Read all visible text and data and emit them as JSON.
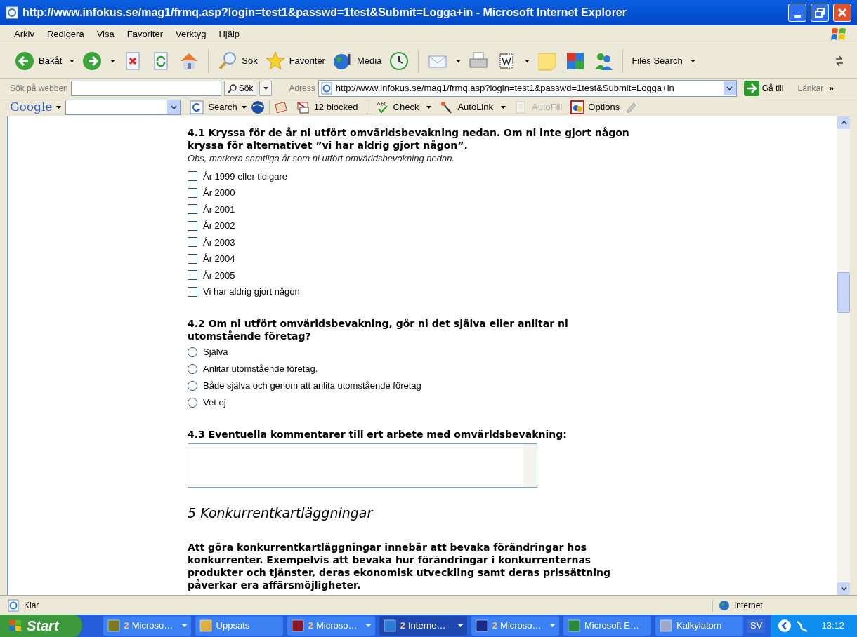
{
  "window": {
    "title": "http://www.infokus.se/mag1/frmq.asp?login=test1&passwd=1test&Submit=Logga+in - Microsoft Internet Explorer"
  },
  "menu": [
    "Arkiv",
    "Redigera",
    "Visa",
    "Favoriter",
    "Verktyg",
    "Hjälp"
  ],
  "toolbar": [
    {
      "label": "Bakåt",
      "dropdown": true
    },
    {
      "dropdown": true
    },
    {
      "dropdown": false
    },
    {
      "dropdown": false
    },
    {
      "dropdown": false
    },
    {
      "label": "Sök",
      "dropdown": false
    },
    {
      "label": "Favoriter",
      "dropdown": false
    },
    {
      "label": "Media",
      "dropdown": false
    },
    {
      "dropdown": false
    },
    {
      "dropdown": true
    },
    {
      "dropdown": false
    },
    {
      "dropdown": true
    },
    {
      "dropdown": false
    },
    {
      "dropdown": false
    },
    {
      "dropdown": false
    },
    {
      "label": "Files Search",
      "dropdown": true
    }
  ],
  "search_bar": {
    "label": "Sök på webben",
    "button": "Sök"
  },
  "address_bar": {
    "label": "Adress",
    "value": "http://www.infokus.se/mag1/frmq.asp?login=test1&passwd=1test&Submit=Logga+in",
    "go": "Gå till",
    "links": "Länkar",
    "more": "»"
  },
  "google_bar": {
    "logo": "Google",
    "search": "Search",
    "items": [
      {
        "label": "12 blocked",
        "dropdown": false,
        "disabled": false
      },
      {
        "label": "Check",
        "dropdown": true,
        "disabled": false
      },
      {
        "label": "AutoLink",
        "dropdown": true,
        "disabled": false
      },
      {
        "label": "AutoFill",
        "dropdown": false,
        "disabled": true
      },
      {
        "label": "Options",
        "dropdown": false,
        "disabled": false
      }
    ]
  },
  "content": {
    "q1": {
      "title": "4.1 Kryssa för de år ni utfört omvärldsbevakning nedan. Om ni inte gjort någon kryssa för alternativet ”vi har aldrig gjort någon”.",
      "note": "Obs, markera samtliga år som ni utfört omvärldsbevakning nedan.",
      "options": [
        {
          "label": "År 1999 eller tidigare",
          "checked": false
        },
        {
          "label": "År 2000",
          "checked": false
        },
        {
          "label": "År 2001",
          "checked": false
        },
        {
          "label": "År 2002",
          "checked": false
        },
        {
          "label": "År 2003",
          "checked": false
        },
        {
          "label": "År 2004",
          "checked": false
        },
        {
          "label": "År 2005",
          "checked": false
        },
        {
          "label": "Vi har aldrig gjort någon",
          "checked": false
        }
      ]
    },
    "q2": {
      "title": "4.2 Om ni utfört omvärldsbevakning, gör ni det själva eller anlitar ni utomstående företag?",
      "options": [
        {
          "label": "Själva",
          "selected": false
        },
        {
          "label": "Anlitar utomstående företag.",
          "selected": false
        },
        {
          "label": "Både själva och genom att anlita utomstående företag",
          "selected": false
        },
        {
          "label": "Vet ej",
          "selected": false
        }
      ]
    },
    "q3": {
      "title": "4.3 Eventuella kommentarer till ert arbete med omvärldsbevakning:"
    },
    "section": {
      "heading": "5 Konkurrentkartläggningar",
      "intro": "Att göra konkurrentkartläggningar innebär att bevaka förändringar hos konkurrenter. Exempelvis att bevaka hur förändringar i konkurrenternas produkter och tjänster, deras ekonomisk utveckling samt deras prissättning påverkar era affärsmöjligheter."
    }
  },
  "status_bar": {
    "text": "Klar",
    "zone": "Internet"
  },
  "taskbar": {
    "start": "Start",
    "items": [
      {
        "count": "2",
        "label": "Microso…",
        "dropdown": true,
        "selected": false
      },
      {
        "label": "Uppsats",
        "dropdown": false,
        "selected": false
      },
      {
        "count": "2",
        "label": "Microso…",
        "dropdown": true,
        "selected": false
      },
      {
        "count": "2",
        "label": "Interne…",
        "dropdown": true,
        "selected": true
      },
      {
        "count": "2",
        "label": "Microso…",
        "dropdown": true,
        "selected": false
      },
      {
        "label": "Microsoft E…",
        "dropdown": false,
        "selected": false
      },
      {
        "label": "Kalkylatorn",
        "dropdown": false,
        "selected": false
      }
    ],
    "language": "SV",
    "clock": "13:12"
  }
}
